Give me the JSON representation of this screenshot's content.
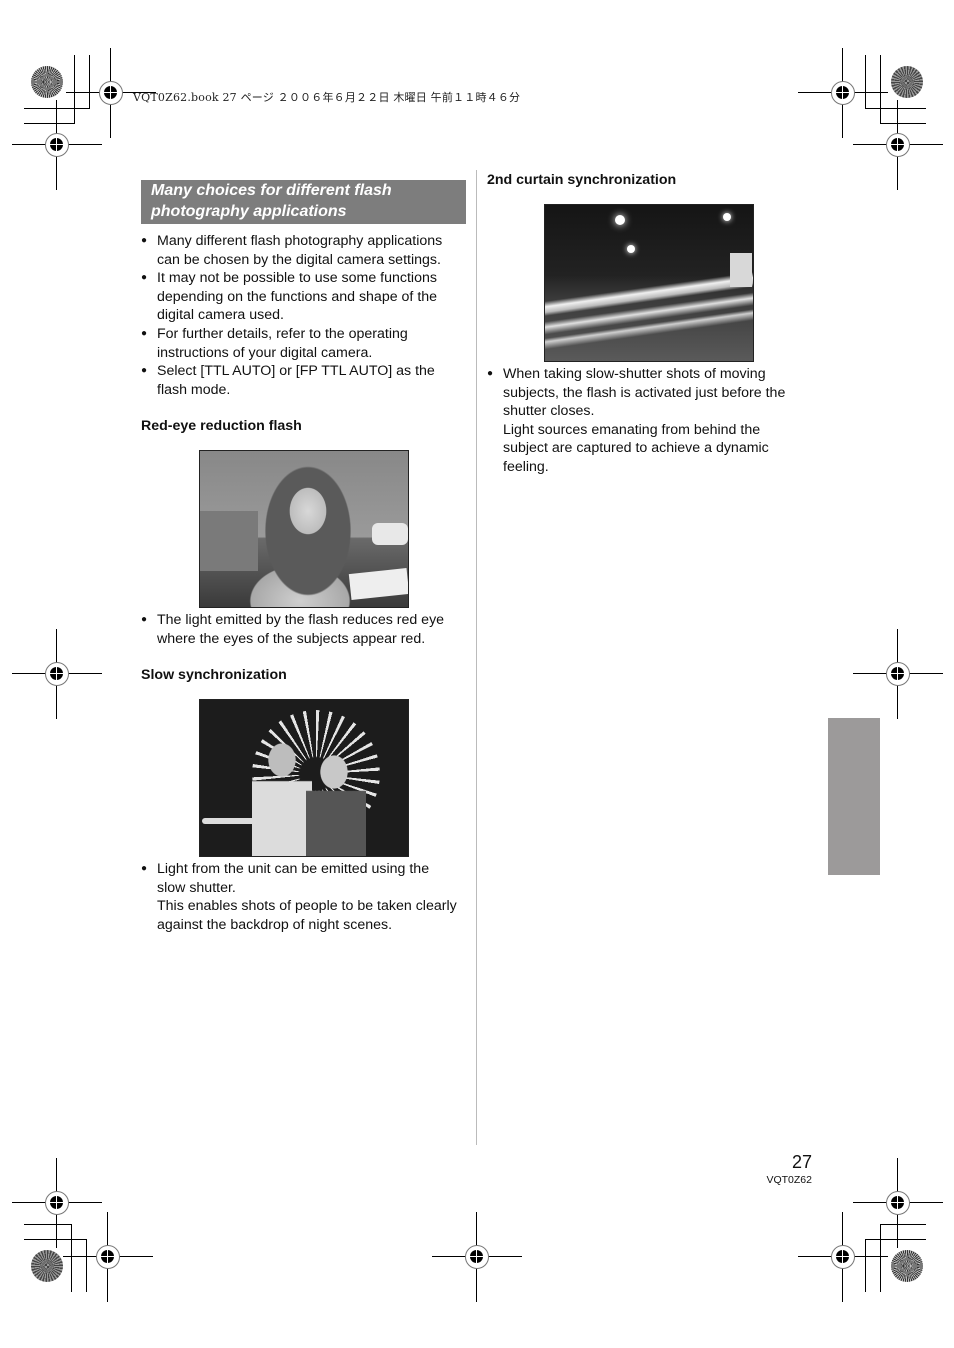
{
  "print_header": {
    "text": "VQT0Z62.book  27 ページ  ２００６年６月２２日  木曜日  午前１１時４６分"
  },
  "left_column": {
    "section_title_line1": "Many choices for different flash",
    "section_title_line2": "photography applications",
    "intro_bullets": [
      "Many different flash photography applications can be chosen by the digital camera settings.",
      "It may not be possible to use some functions depending on the functions and shape of the digital camera used.",
      "For further details, refer to the operating instructions of your digital camera.",
      "Select [TTL AUTO] or [FP TTL AUTO] as the flash mode."
    ],
    "red_eye": {
      "heading": "Red-eye reduction flash",
      "photo": "girl-writing-photo",
      "bullet": "The light emitted by the flash reduces red eye where the eyes of the subjects appear red."
    },
    "slow_sync": {
      "heading": "Slow synchronization",
      "photo": "ferris-wheel-night-photo",
      "bullet_line1": "Light from the unit can be emitted using the slow shutter.",
      "bullet_line2": "This enables shots of people to be taken clearly against the backdrop of night scenes."
    }
  },
  "right_column": {
    "second_curtain": {
      "heading": "2nd curtain synchronization",
      "photo": "night-street-light-trails-photo",
      "bullet_line1": "When taking slow-shutter shots of moving subjects, the flash is activated just before the shutter closes.",
      "bullet_line2": "Light sources emanating from behind the subject are captured to achieve a dynamic feeling."
    }
  },
  "footer": {
    "page_number": "27",
    "doc_code": "VQT0Z62"
  },
  "colors": {
    "section_box": "#7d7d7d",
    "side_tab": "#9c9a9a"
  }
}
